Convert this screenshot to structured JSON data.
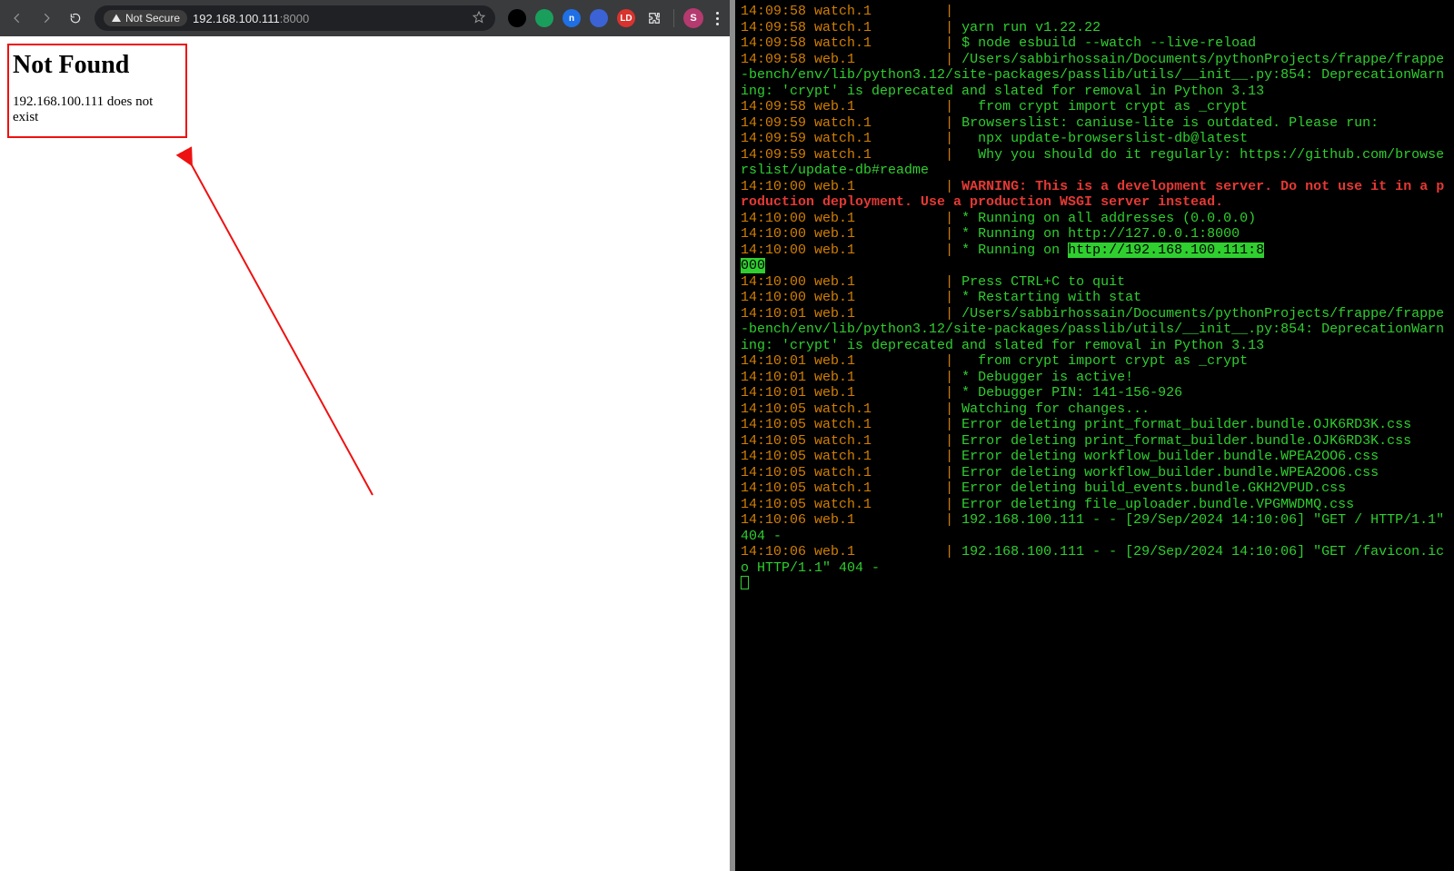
{
  "chrome": {
    "not_secure_label": "Not Secure",
    "url_host": "192.168.100.111",
    "url_port": ":8000",
    "avatar_initial": "S"
  },
  "page": {
    "heading": "Not Found",
    "message": "192.168.100.111 does not exist"
  },
  "extensions": [
    {
      "bg": "#000000",
      "label": ""
    },
    {
      "bg": "#1a9e5c",
      "label": ""
    },
    {
      "bg": "#1f6fe5",
      "label": "n"
    },
    {
      "bg": "#3b63d6",
      "label": ""
    },
    {
      "bg": "#d9332e",
      "label": "LD"
    }
  ],
  "terminal": {
    "highlight_url_a": "http://192.168.100.111:8",
    "highlight_url_b": "000",
    "lines": [
      {
        "ts": "14:09:58",
        "proc": "watch.1",
        "pipe": true,
        "body": ""
      },
      {
        "ts": "14:09:58",
        "proc": "watch.1",
        "pipe": true,
        "body": " yarn run v1.22.22"
      },
      {
        "ts": "14:09:58",
        "proc": "watch.1",
        "pipe": true,
        "body": " $ node esbuild --watch --live-reload"
      },
      {
        "ts": "14:09:58",
        "proc": "web.1",
        "pipe": true,
        "body": " /Users/sabbirhossain/Documents/pythonProjects/frappe/frappe-bench/env/lib/python3.12/site-packages/passlib/utils/__init__.py:854: DeprecationWarning: 'crypt' is deprecated and slated for removal in Python 3.13"
      },
      {
        "ts": "14:09:58",
        "proc": "web.1",
        "pipe": true,
        "body": "   from crypt import crypt as _crypt"
      },
      {
        "ts": "14:09:59",
        "proc": "watch.1",
        "pipe": true,
        "body": " Browserslist: caniuse-lite is outdated. Please run:"
      },
      {
        "ts": "14:09:59",
        "proc": "watch.1",
        "pipe": true,
        "body": "   npx update-browserslist-db@latest"
      },
      {
        "ts": "14:09:59",
        "proc": "watch.1",
        "pipe": true,
        "body": "   Why you should do it regularly: https://github.com/browserslist/update-db#readme"
      },
      {
        "ts": "14:10:00",
        "proc": "web.1",
        "pipe": true,
        "warn": "WARNING: This is a development server. Do not use it in a production deployment. Use a production WSGI server instead."
      },
      {
        "ts": "14:10:00",
        "proc": "web.1",
        "pipe": true,
        "body": " * Running on all addresses (0.0.0.0)"
      },
      {
        "ts": "14:10:00",
        "proc": "web.1",
        "pipe": true,
        "body": " * Running on http://127.0.0.1:8000"
      },
      {
        "ts": "14:10:00",
        "proc": "web.1",
        "pipe": true,
        "body_hl": " * Running on "
      },
      {
        "ts": "14:10:00",
        "proc": "web.1",
        "pipe": true,
        "body": " Press CTRL+C to quit"
      },
      {
        "ts": "14:10:00",
        "proc": "web.1",
        "pipe": true,
        "body": " * Restarting with stat"
      },
      {
        "ts": "14:10:01",
        "proc": "web.1",
        "pipe": true,
        "body": " /Users/sabbirhossain/Documents/pythonProjects/frappe/frappe-bench/env/lib/python3.12/site-packages/passlib/utils/__init__.py:854: DeprecationWarning: 'crypt' is deprecated and slated for removal in Python 3.13"
      },
      {
        "ts": "14:10:01",
        "proc": "web.1",
        "pipe": true,
        "body": "   from crypt import crypt as _crypt"
      },
      {
        "ts": "14:10:01",
        "proc": "web.1",
        "pipe": true,
        "body": " * Debugger is active!"
      },
      {
        "ts": "14:10:01",
        "proc": "web.1",
        "pipe": true,
        "body": " * Debugger PIN: 141-156-926"
      },
      {
        "ts": "14:10:05",
        "proc": "watch.1",
        "pipe": true,
        "body": " Watching for changes..."
      },
      {
        "ts": "14:10:05",
        "proc": "watch.1",
        "pipe": true,
        "body": " Error deleting print_format_builder.bundle.OJK6RD3K.css"
      },
      {
        "ts": "14:10:05",
        "proc": "watch.1",
        "pipe": true,
        "body": " Error deleting print_format_builder.bundle.OJK6RD3K.css"
      },
      {
        "ts": "14:10:05",
        "proc": "watch.1",
        "pipe": true,
        "body": " Error deleting workflow_builder.bundle.WPEA2OO6.css"
      },
      {
        "ts": "14:10:05",
        "proc": "watch.1",
        "pipe": true,
        "body": " Error deleting workflow_builder.bundle.WPEA2OO6.css"
      },
      {
        "ts": "14:10:05",
        "proc": "watch.1",
        "pipe": true,
        "body": " Error deleting build_events.bundle.GKH2VPUD.css"
      },
      {
        "ts": "14:10:05",
        "proc": "watch.1",
        "pipe": true,
        "body": " Error deleting file_uploader.bundle.VPGMWDMQ.css"
      },
      {
        "ts": "14:10:06",
        "proc": "web.1",
        "pipe": true,
        "body": " 192.168.100.111 - - [29/Sep/2024 14:10:06] \"GET / HTTP/1.1\" 404 -"
      },
      {
        "ts": "14:10:06",
        "proc": "web.1",
        "pipe": true,
        "body": " 192.168.100.111 - - [29/Sep/2024 14:10:06] \"GET /favicon.ico HTTP/1.1\" 404 -"
      }
    ]
  }
}
